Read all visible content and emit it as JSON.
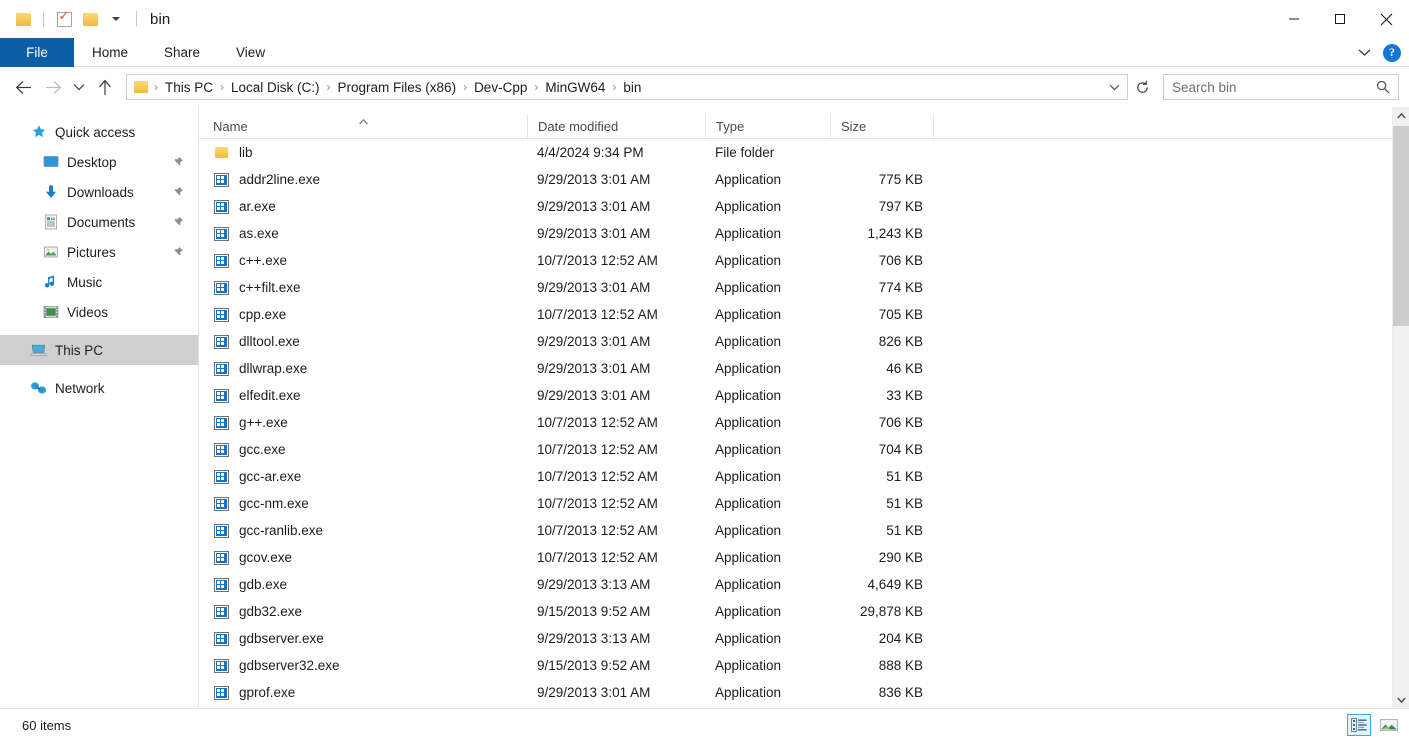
{
  "window": {
    "title": "bin",
    "quick_access_toolbar": [
      {
        "name": "folder-icon",
        "label": "Properties folder"
      },
      {
        "name": "properties-icon",
        "label": "Properties"
      },
      {
        "name": "new-folder-icon",
        "label": "New folder"
      },
      {
        "name": "customize-caret-icon",
        "label": "Customize Quick Access Toolbar"
      }
    ],
    "controls": {
      "minimize": "Minimize",
      "maximize": "Maximize",
      "close": "Close"
    }
  },
  "ribbon": {
    "tabs": [
      {
        "label": "File",
        "active": true
      },
      {
        "label": "Home",
        "active": false
      },
      {
        "label": "Share",
        "active": false
      },
      {
        "label": "View",
        "active": false
      }
    ],
    "expand_label": "Expand the Ribbon",
    "help_label": "?"
  },
  "addressbar": {
    "back": "Back",
    "forward": "Forward",
    "recent": "Recent locations",
    "up": "Up",
    "breadcrumbs": [
      "This PC",
      "Local Disk (C:)",
      "Program Files (x86)",
      "Dev-Cpp",
      "MinGW64",
      "bin"
    ],
    "separator": "›",
    "refresh": "Refresh",
    "dropdown": "Previous locations"
  },
  "search": {
    "placeholder": "Search bin",
    "value": ""
  },
  "sidebar": {
    "items": [
      {
        "label": "Quick access",
        "icon": "star-icon",
        "level": 0,
        "pinned": false,
        "selected": false
      },
      {
        "label": "Desktop",
        "icon": "desktop-icon",
        "level": 1,
        "pinned": true,
        "selected": false
      },
      {
        "label": "Downloads",
        "icon": "download-icon",
        "level": 1,
        "pinned": true,
        "selected": false
      },
      {
        "label": "Documents",
        "icon": "document-icon",
        "level": 1,
        "pinned": true,
        "selected": false
      },
      {
        "label": "Pictures",
        "icon": "picture-icon",
        "level": 1,
        "pinned": true,
        "selected": false
      },
      {
        "label": "Music",
        "icon": "music-note-icon",
        "level": 1,
        "pinned": false,
        "selected": false
      },
      {
        "label": "Videos",
        "icon": "video-icon",
        "level": 1,
        "pinned": false,
        "selected": false
      },
      {
        "label": "This PC",
        "icon": "this-pc-icon",
        "level": 0,
        "pinned": false,
        "selected": true
      },
      {
        "label": "Network",
        "icon": "network-icon",
        "level": 0,
        "pinned": false,
        "selected": false
      }
    ]
  },
  "filelist": {
    "columns": [
      {
        "key": "name",
        "label": "Name",
        "sorted": "asc"
      },
      {
        "key": "date",
        "label": "Date modified",
        "sorted": null
      },
      {
        "key": "type",
        "label": "Type",
        "sorted": null
      },
      {
        "key": "size",
        "label": "Size",
        "sorted": null
      }
    ],
    "rows": [
      {
        "name": "lib",
        "date": "4/4/2024 9:34 PM",
        "type": "File folder",
        "size": "",
        "icon": "folder-icon"
      },
      {
        "name": "addr2line.exe",
        "date": "9/29/2013 3:01 AM",
        "type": "Application",
        "size": "775 KB",
        "icon": "application-icon"
      },
      {
        "name": "ar.exe",
        "date": "9/29/2013 3:01 AM",
        "type": "Application",
        "size": "797 KB",
        "icon": "application-icon"
      },
      {
        "name": "as.exe",
        "date": "9/29/2013 3:01 AM",
        "type": "Application",
        "size": "1,243 KB",
        "icon": "application-icon"
      },
      {
        "name": "c++.exe",
        "date": "10/7/2013 12:52 AM",
        "type": "Application",
        "size": "706 KB",
        "icon": "application-icon"
      },
      {
        "name": "c++filt.exe",
        "date": "9/29/2013 3:01 AM",
        "type": "Application",
        "size": "774 KB",
        "icon": "application-icon"
      },
      {
        "name": "cpp.exe",
        "date": "10/7/2013 12:52 AM",
        "type": "Application",
        "size": "705 KB",
        "icon": "application-icon"
      },
      {
        "name": "dlltool.exe",
        "date": "9/29/2013 3:01 AM",
        "type": "Application",
        "size": "826 KB",
        "icon": "application-icon"
      },
      {
        "name": "dllwrap.exe",
        "date": "9/29/2013 3:01 AM",
        "type": "Application",
        "size": "46 KB",
        "icon": "application-icon"
      },
      {
        "name": "elfedit.exe",
        "date": "9/29/2013 3:01 AM",
        "type": "Application",
        "size": "33 KB",
        "icon": "application-icon"
      },
      {
        "name": "g++.exe",
        "date": "10/7/2013 12:52 AM",
        "type": "Application",
        "size": "706 KB",
        "icon": "application-icon"
      },
      {
        "name": "gcc.exe",
        "date": "10/7/2013 12:52 AM",
        "type": "Application",
        "size": "704 KB",
        "icon": "application-icon"
      },
      {
        "name": "gcc-ar.exe",
        "date": "10/7/2013 12:52 AM",
        "type": "Application",
        "size": "51 KB",
        "icon": "application-icon"
      },
      {
        "name": "gcc-nm.exe",
        "date": "10/7/2013 12:52 AM",
        "type": "Application",
        "size": "51 KB",
        "icon": "application-icon"
      },
      {
        "name": "gcc-ranlib.exe",
        "date": "10/7/2013 12:52 AM",
        "type": "Application",
        "size": "51 KB",
        "icon": "application-icon"
      },
      {
        "name": "gcov.exe",
        "date": "10/7/2013 12:52 AM",
        "type": "Application",
        "size": "290 KB",
        "icon": "application-icon"
      },
      {
        "name": "gdb.exe",
        "date": "9/29/2013 3:13 AM",
        "type": "Application",
        "size": "4,649 KB",
        "icon": "application-icon"
      },
      {
        "name": "gdb32.exe",
        "date": "9/15/2013 9:52 AM",
        "type": "Application",
        "size": "29,878 KB",
        "icon": "application-icon"
      },
      {
        "name": "gdbserver.exe",
        "date": "9/29/2013 3:13 AM",
        "type": "Application",
        "size": "204 KB",
        "icon": "application-icon"
      },
      {
        "name": "gdbserver32.exe",
        "date": "9/15/2013 9:52 AM",
        "type": "Application",
        "size": "888 KB",
        "icon": "application-icon"
      },
      {
        "name": "gprof.exe",
        "date": "9/29/2013 3:01 AM",
        "type": "Application",
        "size": "836 KB",
        "icon": "application-icon"
      }
    ]
  },
  "statusbar": {
    "item_count": "60 items",
    "views": [
      {
        "name": "details-view-button",
        "label": "Details",
        "active": true
      },
      {
        "name": "large-icons-view-button",
        "label": "Large icons",
        "active": false
      }
    ]
  },
  "colors": {
    "accent": "#0b5fa5",
    "selection": "#cfcfcf",
    "help_blue": "#1477d1",
    "folder_yellow": "#f7c85a"
  }
}
